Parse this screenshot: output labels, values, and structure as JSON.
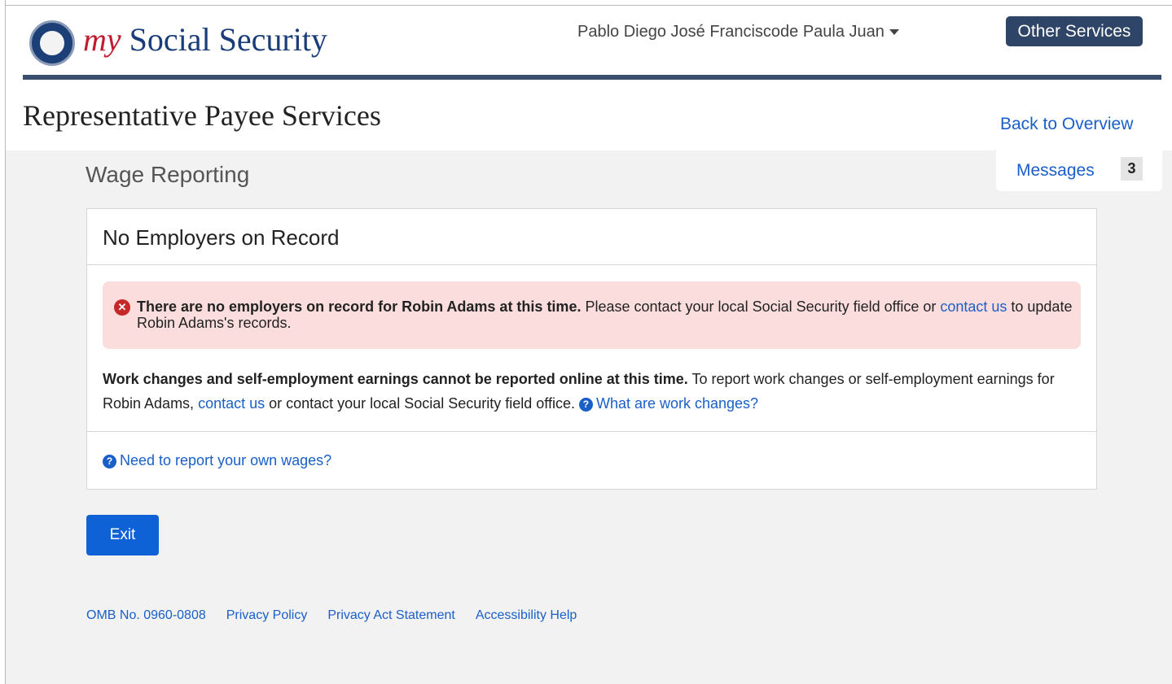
{
  "header": {
    "logo_my": "my",
    "logo_name": "Social Security",
    "user_name": "Pablo Diego José Franciscode Paula Juan",
    "other_services": "Other Services"
  },
  "page": {
    "title": "Representative Payee Services",
    "back_link": "Back to Overview",
    "messages_label": "Messages",
    "messages_count": "3",
    "section_title": "Wage Reporting"
  },
  "card": {
    "title": "No Employers on Record",
    "alert": {
      "bold": "There are no employers on record for Robin Adams at this time.",
      "text_before_link": " Please contact your local Social Security field office or ",
      "link": "contact us",
      "text_after_link": " to update Robin Adams's records."
    },
    "body": {
      "bold": "Work changes and self-employment earnings cannot be reported online at this time.",
      "text1": " To report work changes or self-employment earnings for Robin Adams, ",
      "link1": "contact us",
      "text2": " or contact your local Social Security field office. ",
      "link2": "What are work changes?"
    },
    "own_wages_link": "Need to report your own wages?"
  },
  "actions": {
    "exit": "Exit"
  },
  "footer": {
    "omb": "OMB No. 0960-0808",
    "privacy_policy": "Privacy Policy",
    "privacy_act": "Privacy Act Statement",
    "accessibility": "Accessibility Help"
  },
  "icons": {
    "logo": "ssa-seal-icon",
    "alert": "error-circle-icon",
    "help": "question-circle-icon",
    "dropdown": "caret-down-icon"
  },
  "colors": {
    "brand_navy": "#2f4567",
    "brand_red": "#c21a2e",
    "link": "#1a5fc8",
    "alert_bg": "#fbdddd",
    "primary_button": "#0f62d6"
  }
}
